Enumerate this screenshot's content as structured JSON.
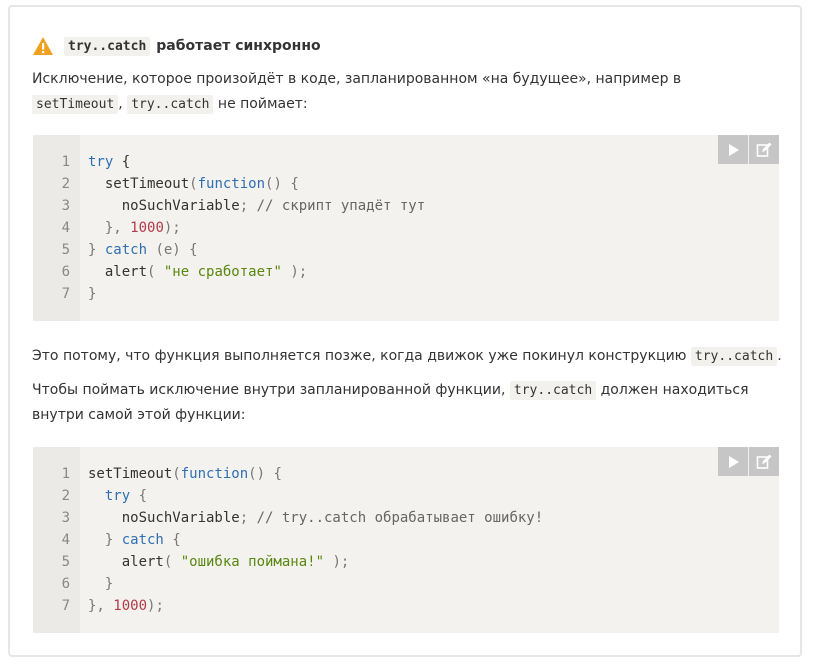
{
  "heading": {
    "code": "try..catch",
    "text": "работает синхронно"
  },
  "intro": {
    "text": "Исключение, которое произойдёт в коде, запланированном «на будущее», например в",
    "code1": "setTimeout",
    "sep": ",",
    "code2": "try..catch",
    "tail": "не поймает:"
  },
  "block1": {
    "lines": [
      {
        "n": "1"
      },
      {
        "n": "2"
      },
      {
        "n": "3"
      },
      {
        "n": "4"
      },
      {
        "n": "5"
      },
      {
        "n": "6"
      },
      {
        "n": "7"
      }
    ],
    "tokens": {
      "l1_kw": "try",
      "l1_p": " {",
      "l2_a": "  setTimeout",
      "l2_p": "(",
      "l2_kw": "function",
      "l2_b": "() {",
      "l3_a": "    noSuchVariable",
      "l3_p": "; ",
      "l3_cm": "// скрипт упадёт тут",
      "l4_a": "  }, ",
      "l4_num": "1000",
      "l4_b": ");",
      "l5_a": "} ",
      "l5_kw": "catch",
      "l5_b": " (e) {",
      "l6_a": "  alert",
      "l6_p": "( ",
      "l6_str": "\"не сработает\"",
      "l6_b": " );",
      "l7_a": "}"
    }
  },
  "middle": {
    "text": "Это потому, что функция выполняется позже, когда движок уже покинул конструкцию",
    "code": "try..catch",
    "dot": "."
  },
  "second": {
    "text1": "Чтобы поймать исключение внутри запланированной функции,",
    "code": "try..catch",
    "text2": "должен находиться",
    "text3": "внутри самой этой функции:"
  },
  "block2": {
    "tokens": {
      "l1_a": "setTimeout",
      "l1_p": "(",
      "l1_kw": "function",
      "l1_b": "() {",
      "l2_a": "  ",
      "l2_kw": "try",
      "l2_b": " {",
      "l3_a": "    noSuchVariable",
      "l3_p": "; ",
      "l3_cm": "// try..catch обрабатывает ошибку!",
      "l4_a": "  } ",
      "l4_kw": "catch",
      "l4_b": " {",
      "l5_a": "    alert",
      "l5_p": "( ",
      "l5_str": "\"ошибка поймана!\"",
      "l5_b": " );",
      "l6_a": "  }",
      "l7_a": "}, ",
      "l7_num": "1000",
      "l7_b": ");"
    }
  },
  "icons": {
    "warning": "warning-icon",
    "run": "play-icon",
    "edit": "edit-icon"
  },
  "colors": {
    "warning": "#f0a020",
    "keyword": "#2f6fb2",
    "number": "#b23a48",
    "string": "#57870f"
  }
}
